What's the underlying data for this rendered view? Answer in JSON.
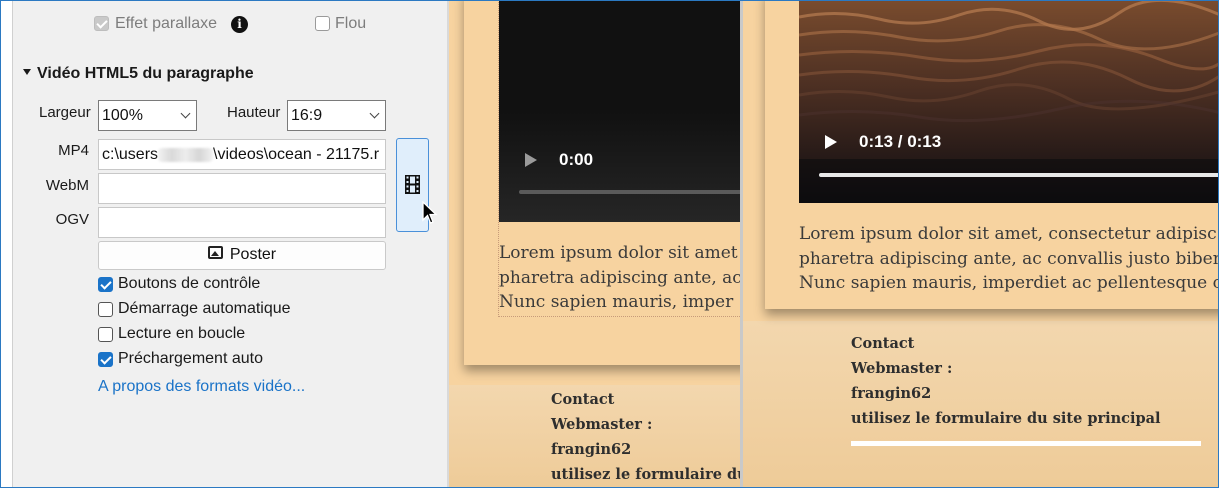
{
  "panel": {
    "parallax": {
      "label": "Effet parallaxe",
      "checked": true,
      "disabled": true
    },
    "flou": {
      "label": "Flou",
      "checked": false
    },
    "section_title": "Vidéo HTML5 du paragraphe",
    "largeur": {
      "label": "Largeur",
      "value": "100%"
    },
    "hauteur": {
      "label": "Hauteur",
      "value": "16:9"
    },
    "mp4": {
      "label": "MP4",
      "value_prefix": "c:\\users",
      "value_suffix": "\\videos\\ocean - 21175.r"
    },
    "webm": {
      "label": "WebM",
      "value": ""
    },
    "ogv": {
      "label": "OGV",
      "value": ""
    },
    "poster_label": "Poster",
    "options": [
      {
        "label": "Boutons de contrôle",
        "checked": true
      },
      {
        "label": "Démarrage automatique",
        "checked": false
      },
      {
        "label": "Lecture en boucle",
        "checked": false
      },
      {
        "label": "Préchargement auto",
        "checked": true
      }
    ],
    "link": "A propos des formats vidéo..."
  },
  "preview_left": {
    "video_time": "0:00",
    "lorem": [
      "Lorem ipsum dolor sit amet",
      "pharetra adipiscing ante, ac",
      "Nunc sapien mauris, imper"
    ],
    "footer": [
      "Contact",
      "Webmaster :",
      "frangin62",
      "utilisez le formulaire du"
    ]
  },
  "preview_right": {
    "video_time": "0:13 / 0:13",
    "lorem": [
      "Lorem ipsum dolor sit amet, consectetur adipisc",
      "pharetra adipiscing ante, ac convallis justo biben",
      "Nunc sapien mauris, imperdiet ac pellentesque c"
    ],
    "footer": [
      "Contact",
      "Webmaster :",
      "frangin62",
      "utilisez le formulaire du site principal"
    ]
  },
  "icons": {
    "info": "info-icon",
    "browse": "film-strip-icon",
    "poster": "image-icon",
    "cursor": "mouse-pointer-icon",
    "play": "play-icon"
  },
  "colors": {
    "accent": "#1a73c8",
    "page_bg": "#f3d7ae",
    "card_bg": "#f7d3a0"
  }
}
